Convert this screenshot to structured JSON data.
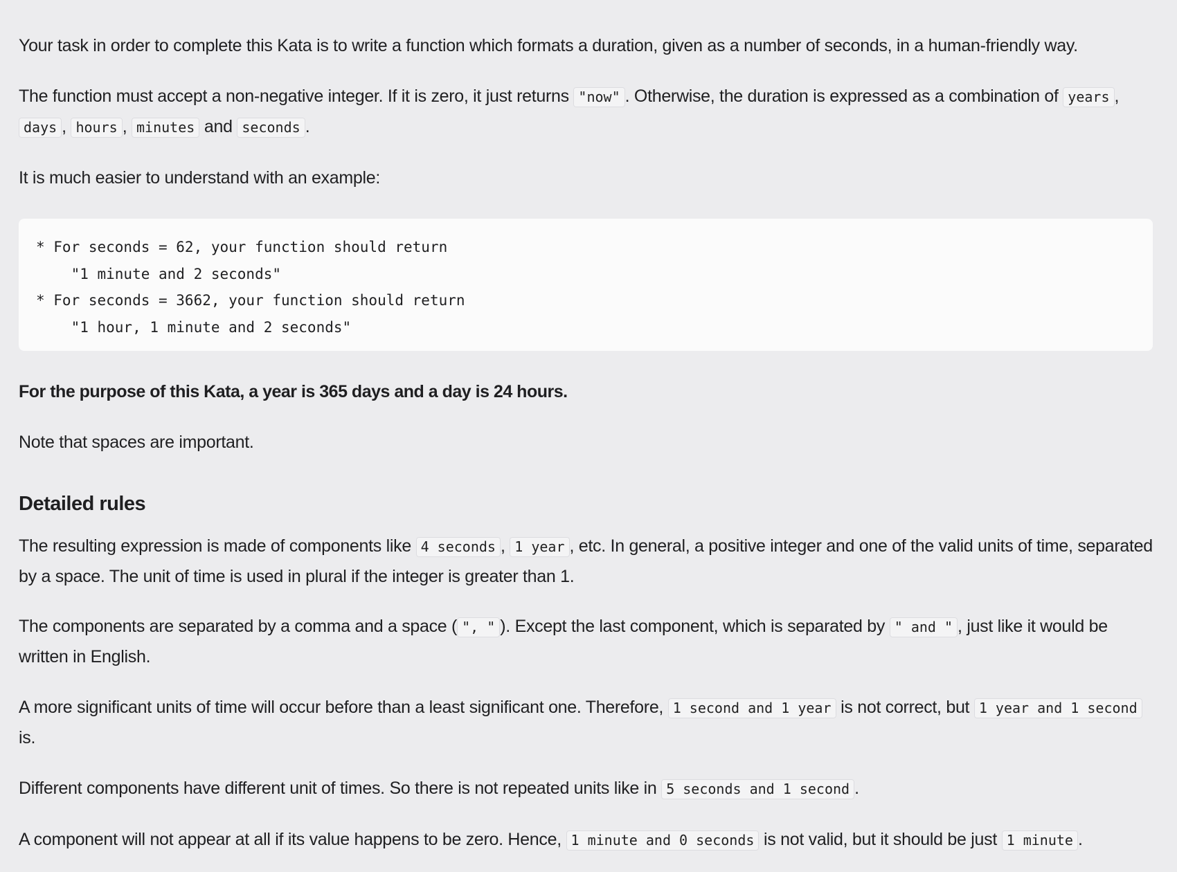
{
  "intro": "Your task in order to complete this Kata is to write a function which formats a duration, given as a number of seconds, in a human-friendly way.",
  "accept": {
    "t1": "The function must accept a non-negative integer. If it is zero, it just returns ",
    "c_now": "\"now\"",
    "t2": ". Otherwise, the duration is expressed as a combination of ",
    "c_years": "years",
    "t3": ", ",
    "c_days": "days",
    "t4": ", ",
    "c_hours": "hours",
    "t5": ", ",
    "c_minutes": "minutes",
    "t6": " and ",
    "c_seconds": "seconds",
    "t7": "."
  },
  "easier": "It is much easier to understand with an example:",
  "example_lines": [
    "* For seconds = 62, your function should return ",
    "    \"1 minute and 2 seconds\"",
    "* For seconds = 3662, your function should return",
    "    \"1 hour, 1 minute and 2 seconds\""
  ],
  "bold_note": "For the purpose of this Kata, a year is 365 days and a day is 24 hours.",
  "spaces_note": "Note that spaces are important.",
  "detailed_heading": "Detailed rules",
  "result": {
    "t1": "The resulting expression is made of components like ",
    "c1": "4 seconds",
    "t2": ", ",
    "c2": "1 year",
    "t3": ", etc. In general, a positive integer and one of the valid units of time, separated by a space. The unit of time is used in plural if the integer is greater than 1."
  },
  "components": {
    "t1": "The components are separated by a comma and a space (",
    "c1": "\", \"",
    "t2": "). Except the last component, which is separated by ",
    "c2": "\" and \"",
    "t3": ", just like it would be written in English."
  },
  "significant": {
    "t1": "A more significant units of time will occur before than a least significant one. Therefore, ",
    "c1": "1 second and 1 year",
    "t2": " is not correct, but ",
    "c2": "1 year and 1 second",
    "t3": " is."
  },
  "different": {
    "t1": "Different components have different unit of times. So there is not repeated units like in ",
    "c1": "5 seconds and 1 second",
    "t2": "."
  },
  "zero": {
    "t1": "A component will not appear at all if its value happens to be zero. Hence, ",
    "c1": "1 minute and 0 seconds",
    "t2": " is not valid, but it should be just ",
    "c2": "1 minute",
    "t3": "."
  }
}
